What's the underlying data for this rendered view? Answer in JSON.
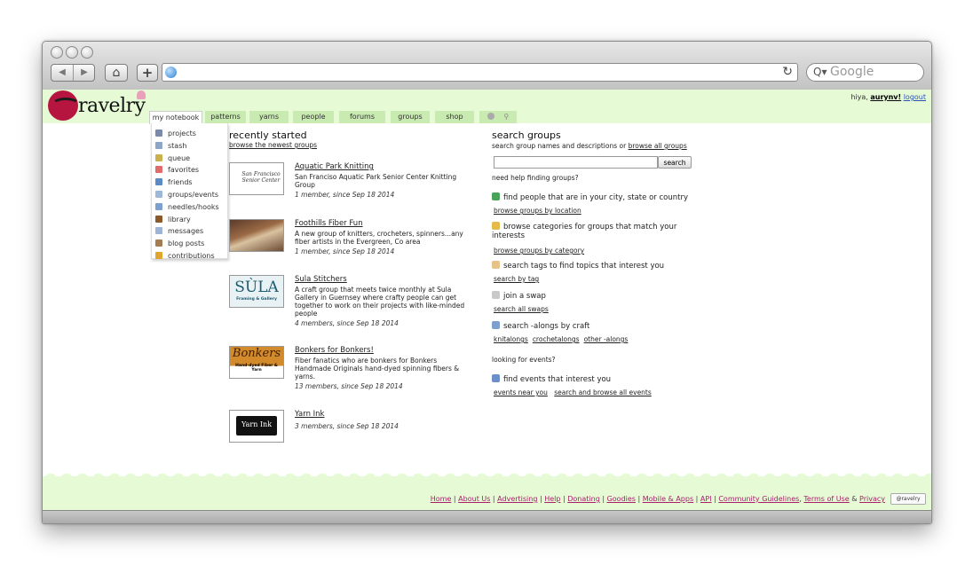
{
  "browser": {
    "search_placeholder": "Google",
    "back_label": "◀",
    "forward_label": "▶",
    "home_label": "⌂",
    "add_label": "+",
    "reload_label": "↻"
  },
  "site": {
    "logo_text": "ravelry",
    "greeting": "hiya,",
    "username": "aurynv!",
    "logout": "logout"
  },
  "nav": {
    "tabs": [
      "my notebook",
      "patterns",
      "yarns",
      "people",
      "forums",
      "groups",
      "shop"
    ]
  },
  "notebook_menu": [
    {
      "label": "projects",
      "icon": "grid-icon",
      "color": "#7a8aa8"
    },
    {
      "label": "stash",
      "icon": "stash-icon",
      "color": "#8da6c7"
    },
    {
      "label": "queue",
      "icon": "queue-icon",
      "color": "#c9b24d"
    },
    {
      "label": "favorites",
      "icon": "heart-icon",
      "color": "#e36a6a"
    },
    {
      "label": "friends",
      "icon": "friends-icon",
      "color": "#5a8bc7"
    },
    {
      "label": "groups/events",
      "icon": "speech-icon",
      "color": "#9fb7d8"
    },
    {
      "label": "needles/hooks",
      "icon": "needles-icon",
      "color": "#7ea0cf"
    },
    {
      "label": "library",
      "icon": "library-icon",
      "color": "#8a5a2a"
    },
    {
      "label": "messages",
      "icon": "envelope-icon",
      "color": "#9db4d6"
    },
    {
      "label": "blog posts",
      "icon": "house-icon",
      "color": "#a67c52"
    },
    {
      "label": "contributions",
      "icon": "pencil-icon",
      "color": "#e0a52c"
    }
  ],
  "recent": {
    "title": "recently started",
    "subtitle": "browse the newest groups",
    "groups": [
      {
        "name": "Aquatic Park Knitting",
        "desc": "San Franciso Aquatic Park Senior Center Knitting Group",
        "meta": "1 member, since Sep 18 2014",
        "thumb_text": "San Francisco Senior Center"
      },
      {
        "name": "Foothills Fiber Fun",
        "desc": "A new group of knitters, crocheters, spinners...any fiber artists in the Evergreen, Co area",
        "meta": "1 member, since Sep 18 2014",
        "thumb_text": ""
      },
      {
        "name": "Sula Stitchers",
        "desc": "A craft group that meets twice monthly at Sula Gallery in Guernsey where crafty people can get together to work on their projects with like-minded people",
        "meta": "4 members, since Sep 18 2014",
        "thumb_text": "SÙLA",
        "thumb_sub": "Framing & Gallery"
      },
      {
        "name": "Bonkers for Bonkers!",
        "desc": "Fiber fanatics who are bonkers for Bonkers Handmade Originals hand-dyed spinning fibers & yarns.",
        "meta": "13 members, since Sep 18 2014",
        "thumb_text": "Bonkers",
        "thumb_sub": "Hand-dyed Fiber & Yarn"
      },
      {
        "name": "Yarn Ink",
        "desc": "",
        "meta": "3 members, since Sep 18 2014",
        "thumb_text": "Yarn Ink"
      }
    ]
  },
  "search": {
    "title": "search groups",
    "subtitle_prefix": "search group names and descriptions or ",
    "subtitle_link": "browse all groups",
    "input_value": "",
    "button": "search"
  },
  "help": {
    "title": "need help finding groups?",
    "items": [
      {
        "text": "find people that are in your city, state or country",
        "icon": "globe-icon",
        "color": "#4aa35a",
        "links": [
          "browse groups by location"
        ]
      },
      {
        "text": "browse categories for groups that match your interests",
        "icon": "folder-icon",
        "color": "#e5b94a",
        "links": [
          "browse groups by category"
        ]
      },
      {
        "text": "search tags to find topics that interest you",
        "icon": "tag-icon",
        "color": "#e7c38a",
        "links": [
          "search by tag"
        ]
      },
      {
        "text": "join a swap",
        "icon": "swap-icon",
        "color": "#c9c9c9",
        "links": [
          "search all swaps"
        ]
      },
      {
        "text": "search -alongs by craft",
        "icon": "needles-icon",
        "color": "#7ea0cf",
        "links": [
          "knitalongs",
          "crochetalongs",
          "other -alongs"
        ]
      }
    ]
  },
  "events": {
    "title": "looking for events?",
    "text": "find events that interest you",
    "icon_color": "#6d8fc9",
    "links": [
      "events near you",
      "search and browse all events"
    ]
  },
  "footer": {
    "links": [
      "Home",
      "About Us",
      "Advertising",
      "Help",
      "Donating",
      "Goodies",
      "Mobile & Apps",
      "API",
      "Community Guidelines",
      "Terms of Use",
      "Privacy"
    ],
    "twitter": "@ravelry"
  }
}
